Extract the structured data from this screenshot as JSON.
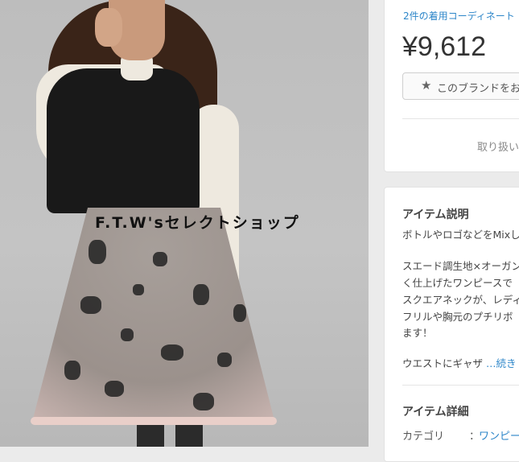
{
  "photo": {
    "watermark": "F.T.W'sセレクトショップ"
  },
  "summary": {
    "coordinate_link": "2件の着用コーディネート",
    "price": "¥9,612",
    "brand_button_label": "このブランドをお",
    "handling_text": "取り扱い"
  },
  "description": {
    "title": "アイテム説明",
    "lines": [
      "ボトルやロゴなどをMixし",
      "スエード調生地×オーガン",
      "く仕上げたワンピースで",
      "スクエアネックが、レディ",
      "フリルや胸元のプチリボ",
      "ます！",
      "ウエストにギャザ"
    ],
    "more_link": "…続き"
  },
  "details": {
    "title": "アイテム詳細",
    "category_label": "カテゴリ",
    "colon": "：",
    "category_value": "ワンピー"
  }
}
